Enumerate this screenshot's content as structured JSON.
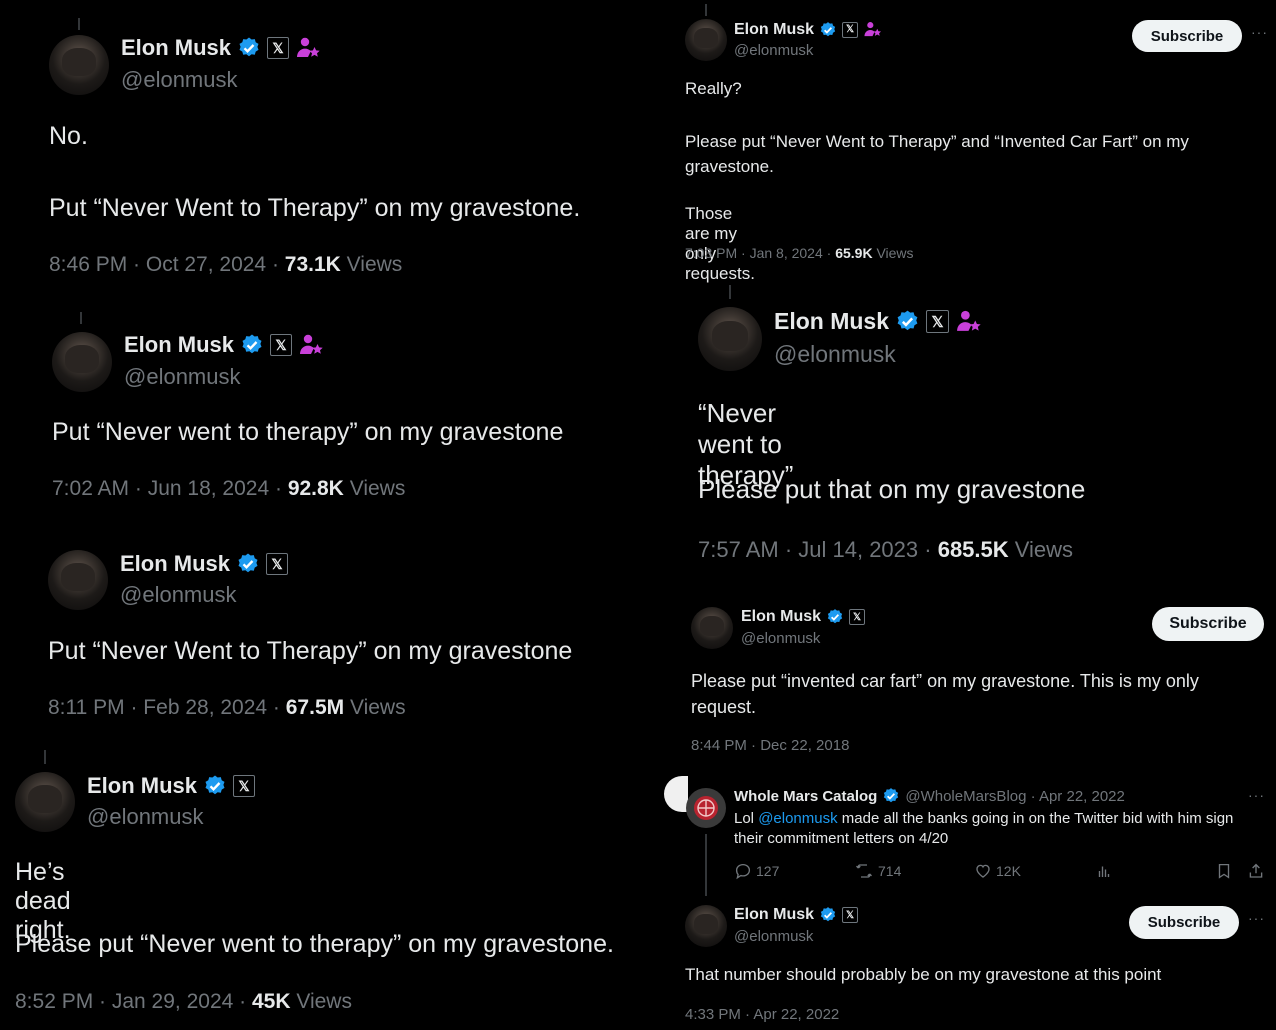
{
  "profile": {
    "name": "Elon Musk",
    "handle": "@elonmusk"
  },
  "buttons": {
    "subscribe": "Subscribe",
    "more": "···"
  },
  "tweets": [
    {
      "lines": [
        "No.",
        "Put “Never Went to Therapy” on my gravestone."
      ],
      "time": "8:46 PM · Oct 27, 2024 · ",
      "views": "73.1K",
      "views_label": " Views"
    },
    {
      "lines": [
        "Put “Never went to therapy” on my gravestone"
      ],
      "time": "7:02 AM · Jun 18, 2024 · ",
      "views": "92.8K",
      "views_label": " Views"
    },
    {
      "lines": [
        "Put “Never Went to Therapy” on my gravestone"
      ],
      "time": "8:11 PM · Feb 28, 2024 · ",
      "views": "67.5M",
      "views_label": " Views"
    },
    {
      "lines": [
        "He’s dead right.",
        "Please put “Never went to therapy” on my gravestone."
      ],
      "time": "8:52 PM · Jan 29, 2024 · ",
      "views": "45K",
      "views_label": " Views"
    },
    {
      "lines": [
        "Really?",
        "Please put “Never Went to Therapy” and “Invented Car Fart” on my gravestone.",
        "Those are my only requests."
      ],
      "time": "7:03 PM · Jan 8, 2024 · ",
      "views": "65.9K",
      "views_label": " Views"
    },
    {
      "lines": [
        "“Never went to therapy”",
        "Please put that on my gravestone"
      ],
      "time": "7:57 AM · Jul 14, 2023 · ",
      "views": "685.5K",
      "views_label": " Views"
    },
    {
      "lines": [
        "Please put “invented car fart” on my gravestone. This is my only request."
      ],
      "time": "8:44 PM · Dec 22, 2018"
    },
    {
      "lines": [
        "That number should probably be on my gravestone at this point"
      ],
      "time": "4:33 PM · Apr 22, 2022"
    }
  ],
  "quoted": {
    "name": "Whole Mars Catalog",
    "handle_time": "@WholeMarsBlog · Apr 22, 2022",
    "text_pre": "Lol ",
    "mention": "@elonmusk",
    "text_post": " made all the banks going in on the Twitter bid with him sign their commitment letters on 4/20",
    "replies": "127",
    "retweets": "714",
    "likes": "12K"
  },
  "icons": [
    "verified-badge-icon",
    "x-badge-icon",
    "affiliate-person-icon",
    "reply-icon",
    "retweet-icon",
    "like-icon",
    "views-chart-icon",
    "bookmark-icon",
    "share-icon",
    "more-icon"
  ],
  "colors": {
    "background": "#000000",
    "text": "#e7e9ea",
    "muted": "#71767b",
    "verified": "#1d9bf0",
    "affiliate": "#c940d9",
    "mention": "#1d9bf0"
  }
}
